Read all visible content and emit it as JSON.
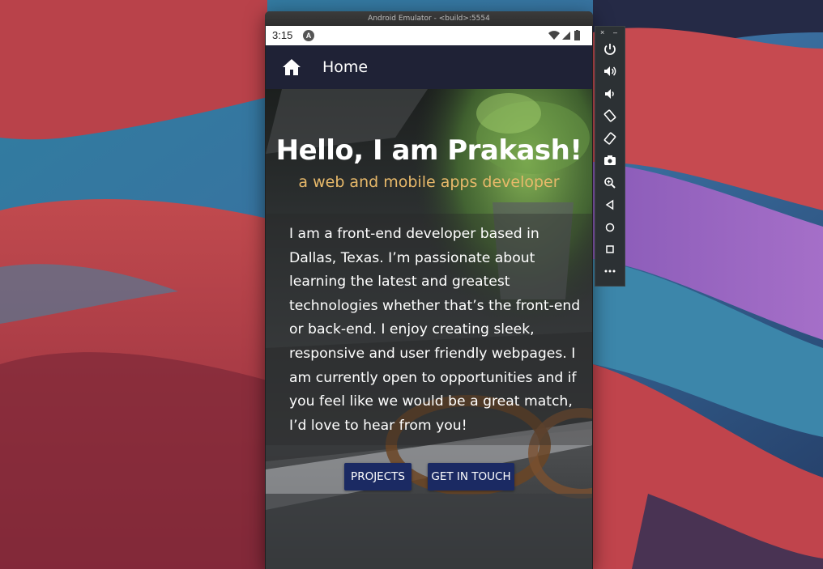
{
  "window": {
    "title": "Android Emulator - <build>:5554"
  },
  "status_bar": {
    "time": "3:15",
    "app_icon_letter": "A"
  },
  "app_bar": {
    "title": "Home",
    "icon": "home-icon"
  },
  "hero": {
    "title": "Hello, I am Prakash!",
    "subtitle": "a web and mobile apps developer",
    "bio": "I am a front-end developer based in Dallas, Texas. I’m passionate about learning the latest and greatest technologies whether that’s the front-end or back-end. I enjoy creating sleek, responsive and user friendly webpages. I am currently open to opportunities and if you feel like we would be a great match, I’d love to hear from you!",
    "buttons": {
      "projects": "PROJECTS",
      "contact": "GET IN TOUCH"
    }
  },
  "toolbar": {
    "close": "×",
    "minimize": "–",
    "icons": [
      "power-icon",
      "volume-up-icon",
      "volume-down-icon",
      "rotate-left-icon",
      "rotate-right-icon",
      "camera-icon",
      "zoom-icon",
      "back-icon",
      "home-circle-icon",
      "overview-icon",
      "more-icon"
    ]
  },
  "colors": {
    "app_bar": "#1f2236",
    "button": "#1b2a63",
    "subtitle": "#e8b96a"
  }
}
